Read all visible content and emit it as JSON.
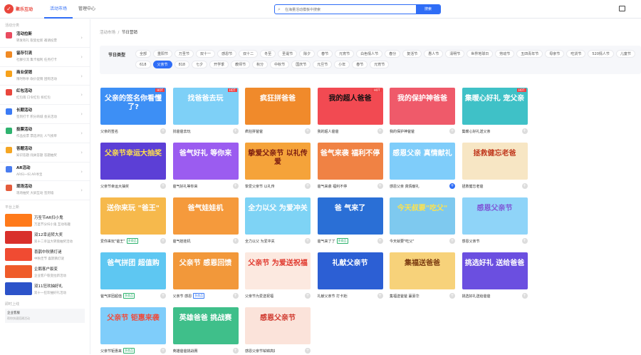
{
  "app": {
    "logo_glyph": "✓",
    "logo_text": "聚乐互动"
  },
  "topnav": [
    {
      "label": "活动市场",
      "active": true
    },
    {
      "label": "管理中心",
      "active": false
    }
  ],
  "search": {
    "placeholder": "在海量活动模板中搜索",
    "button": "搜索"
  },
  "sidebar": {
    "heading": "活动分类",
    "items": [
      {
        "title": "活动拉新",
        "sub": "转发有礼  裂变拉新  邀请投票",
        "color": "#e94b5f"
      },
      {
        "title": "留存引流",
        "sub": "社群引流  集卡福利  任务打卡",
        "color": "#f08a24"
      },
      {
        "title": "商业促销",
        "sub": "限时秒杀  砍价促销  团购活动",
        "color": "#f7a21b"
      },
      {
        "title": "红包活动",
        "sub": "红包雨  口令红包  拆红包",
        "color": "#e9463c"
      },
      {
        "title": "长期活动",
        "sub": "签到打卡  积分商城  会员活动",
        "color": "#3b7bf5"
      },
      {
        "title": "投票活动",
        "sub": "作品投票  票选评比  人气榜单",
        "color": "#2fb36f"
      },
      {
        "title": "答题活动",
        "sub": "知识答题  闯关答题  答题抽奖",
        "color": "#f5a623"
      },
      {
        "title": "AR活动",
        "sub": "AR扫一扫  AR寻宝",
        "color": "#4a7df0"
      },
      {
        "title": "现场活动",
        "sub": "现场抽奖  大屏互动  签到墙",
        "color": "#e45c3c"
      }
    ],
    "news_heading": "平台上新",
    "news": [
      {
        "title": "万圣节AR扫小鬼",
        "sub": "万圣节分扫小鬼 互动有趣",
        "color": "#ff7a1a"
      },
      {
        "title": "双12幸运转大奖",
        "sub": "双十二幸运大转盘抽奖活动",
        "color": "#d9302b"
      },
      {
        "title": "喜鹊中秋猜灯谜",
        "sub": "中秋佳节 喜鹊猜灯谜",
        "color": "#f04b32"
      },
      {
        "title": "企鹅客户裂变",
        "sub": "企业客户裂变拉新活动",
        "color": "#ef5b2a"
      },
      {
        "title": "双11狂欢抽好礼",
        "sub": "双十一狂欢抽好礼活动",
        "color": "#2c53c9"
      }
    ],
    "msg_heading": "即时上线",
    "msg": {
      "title": "企业客服",
      "sub": "帮你快速搭建活动"
    }
  },
  "breadcrumb": {
    "root": "活动市场",
    "sep": "/",
    "current": "节日营销"
  },
  "filter": {
    "label": "节日类型",
    "tags": [
      "全部",
      "重阳节",
      "万圣节",
      "双十一",
      "感恩节",
      "双十二",
      "冬至",
      "圣诞节",
      "除夕",
      "春节",
      "元宵节",
      "白色情人节",
      "春分",
      "复活节",
      "愚人节",
      "清明节",
      "世界地球日",
      "劳动节",
      "五四青年节",
      "母亲节",
      "吃货节",
      "520情人节",
      "儿童节",
      "618",
      "父亲节",
      "818",
      "七夕",
      "开学季",
      "教师节",
      "秋分",
      "中秋节",
      "国庆节",
      "元旦节",
      "小年",
      "春节",
      "元宵节"
    ],
    "active_index": 24
  },
  "cards": [
    {
      "title": "父亲的签名你看懂了?",
      "name": "父亲的签名",
      "badge": "HOT",
      "hot": true,
      "bg": "#3d8ff5",
      "fg": "#fff",
      "tag": "",
      "tagcolor": "#e9463c"
    },
    {
      "title": "找爸爸去玩",
      "name": "找爸爸去玩",
      "badge": "HOT",
      "hot": true,
      "bg": "#7ed0f7",
      "fg": "#fff",
      "tag": "",
      "tagcolor": "#e9463c"
    },
    {
      "title": "疯狂拼爸爸",
      "name": "疯狂拼爸爸",
      "badge": "",
      "hot": false,
      "bg": "#f08a2b",
      "fg": "#fff",
      "tag": "",
      "tagcolor": "#e9463c"
    },
    {
      "title": "我的超人爸爸",
      "name": "我的超人爸爸",
      "badge": "HOT",
      "hot": true,
      "bg": "#f24a52",
      "fg": "#111",
      "tag": "",
      "tagcolor": "#e9463c"
    },
    {
      "title": "我的保护神爸爸",
      "name": "我的保护神爸爸",
      "badge": "",
      "hot": false,
      "bg": "#ef5a6a",
      "fg": "#fff",
      "tag": "",
      "tagcolor": "#e9463c"
    },
    {
      "title": "集暖心好礼 宠父亲",
      "name": "集暖心好礼送父亲",
      "badge": "HOT",
      "hot": true,
      "bg": "#3fc1c7",
      "fg": "#fff",
      "tag": "",
      "tagcolor": "#e9463c"
    },
    {
      "title": "父亲节幸运大抽奖",
      "name": "父亲节幸运大抽奖",
      "badge": "",
      "hot": false,
      "bg": "#5c3fd6",
      "fg": "#ffe34a",
      "tag": "",
      "tagcolor": "#e9463c"
    },
    {
      "title": "爸气好礼 等你来",
      "name": "爸气好礼等你来",
      "badge": "",
      "hot": false,
      "bg": "#9b5cf0",
      "fg": "#fff",
      "tag": "",
      "tagcolor": "#e9463c"
    },
    {
      "title": "挚爱父亲节 以礼传爱",
      "name": "挚爱父亲节 以礼传爱",
      "badge": "",
      "hot": false,
      "bg": "#f5a33a",
      "fg": "#7a1b10",
      "tag": "",
      "tagcolor": "#e9463c"
    },
    {
      "title": "爸气来袭 福利不停",
      "name": "爸气来袭 福利不停",
      "badge": "",
      "hot": false,
      "bg": "#f08244",
      "fg": "#fff",
      "tag": "",
      "tagcolor": "#e9463c"
    },
    {
      "title": "感恩父亲 真情献礼",
      "name": "感恩父亲 真情献礼",
      "badge": "",
      "hot": false,
      "bg": "#7fcdfa",
      "fg": "#fff",
      "tag": "",
      "tagcolor": "#e9463c"
    },
    {
      "title": "拯救健忘老爸",
      "name": "拯救健忘老爸",
      "badge": "",
      "hot": false,
      "bg": "#f7e6c4",
      "fg": "#c0391e",
      "tag": "",
      "tagcolor": "#e9463c"
    },
    {
      "title": "送你来玩 \"爸王\"",
      "name": "爱你来玩\"爸王\"",
      "badge": "",
      "hot": false,
      "bg": "#f6b94c",
      "fg": "#fff",
      "tag": "多商品",
      "tagcolor": "#2fb36f"
    },
    {
      "title": "爸气娃娃机",
      "name": "爸气娃娃机",
      "badge": "",
      "hot": false,
      "bg": "#f59a3c",
      "fg": "#fff",
      "tag": "",
      "tagcolor": "#e9463c"
    },
    {
      "title": "全力以父 为爱冲关",
      "name": "全力以父 为爱冲关",
      "badge": "",
      "hot": false,
      "bg": "#7ed3f5",
      "fg": "#fff",
      "tag": "",
      "tagcolor": "#e9463c"
    },
    {
      "title": "爸 气来了",
      "name": "爸气来了了",
      "badge": "",
      "hot": false,
      "bg": "#2a6fd6",
      "fg": "#fff",
      "tag": "多商品",
      "tagcolor": "#2fb36f"
    },
    {
      "title": "今天叔要\"吃父\"",
      "name": "今天就要\"吃父\"",
      "badge": "",
      "hot": false,
      "bg": "#7ec9ef",
      "fg": "#ffe34a",
      "tag": "",
      "tagcolor": "#e9463c"
    },
    {
      "title": "感恩父亲节",
      "name": "感恩父亲节",
      "badge": "",
      "hot": false,
      "bg": "#8fd4f8",
      "fg": "#7f57d6",
      "tag": "",
      "tagcolor": "#e9463c"
    },
    {
      "title": "爸气拼团 超值购",
      "name": "爸气拼团超值",
      "badge": "",
      "hot": false,
      "bg": "#5ec7f2",
      "fg": "#fff",
      "tag": "多商品",
      "tagcolor": "#2fb36f"
    },
    {
      "title": "父亲节 感恩回馈",
      "name": "父亲节 感恩",
      "badge": "",
      "hot": false,
      "bg": "#f2983a",
      "fg": "#fff",
      "tag": "多商品",
      "tagcolor": "#3b7bf5"
    },
    {
      "title": "父亲节 为爱送祝福",
      "name": "父亲节为爱送祝福",
      "badge": "",
      "hot": false,
      "bg": "#fce9e0",
      "fg": "#e0392e",
      "tag": "",
      "tagcolor": "#e9463c"
    },
    {
      "title": "礼献父亲节",
      "name": "礼献父亲节 打卡抢豪礼",
      "badge": "",
      "hot": false,
      "bg": "#2c5fd4",
      "fg": "#fff",
      "tag": "",
      "tagcolor": "#e9463c"
    },
    {
      "title": "集福送爸爸",
      "name": "集福送爸爸 赢豪华好礼",
      "badge": "",
      "hot": false,
      "bg": "#f7d27a",
      "fg": "#7a3a10",
      "tag": "",
      "tagcolor": "#e9463c"
    },
    {
      "title": "挑选好礼 送给爸爸",
      "name": "挑选好礼送给爸爸",
      "badge": "",
      "hot": false,
      "bg": "#6b4fe0",
      "fg": "#fff",
      "tag": "",
      "tagcolor": "#e9463c"
    },
    {
      "title": "父亲节 钜惠来袭",
      "name": "父亲节钜惠来",
      "badge": "",
      "hot": false,
      "bg": "#7fcdfa",
      "fg": "#ef4b3c",
      "tag": "多商品",
      "tagcolor": "#2fb36f"
    },
    {
      "title": "英雄爸爸 挑战赛",
      "name": "英雄爸爸挑战赛",
      "badge": "",
      "hot": false,
      "bg": "#3fbf8a",
      "fg": "#fff",
      "tag": "",
      "tagcolor": "#e9463c"
    },
    {
      "title": "感恩父亲节",
      "name": "感恩父亲节铂锦高好礼",
      "badge": "",
      "hot": false,
      "bg": "#fbe3da",
      "fg": "#d0392e",
      "tag": "",
      "tagcolor": "#e9463c"
    }
  ]
}
